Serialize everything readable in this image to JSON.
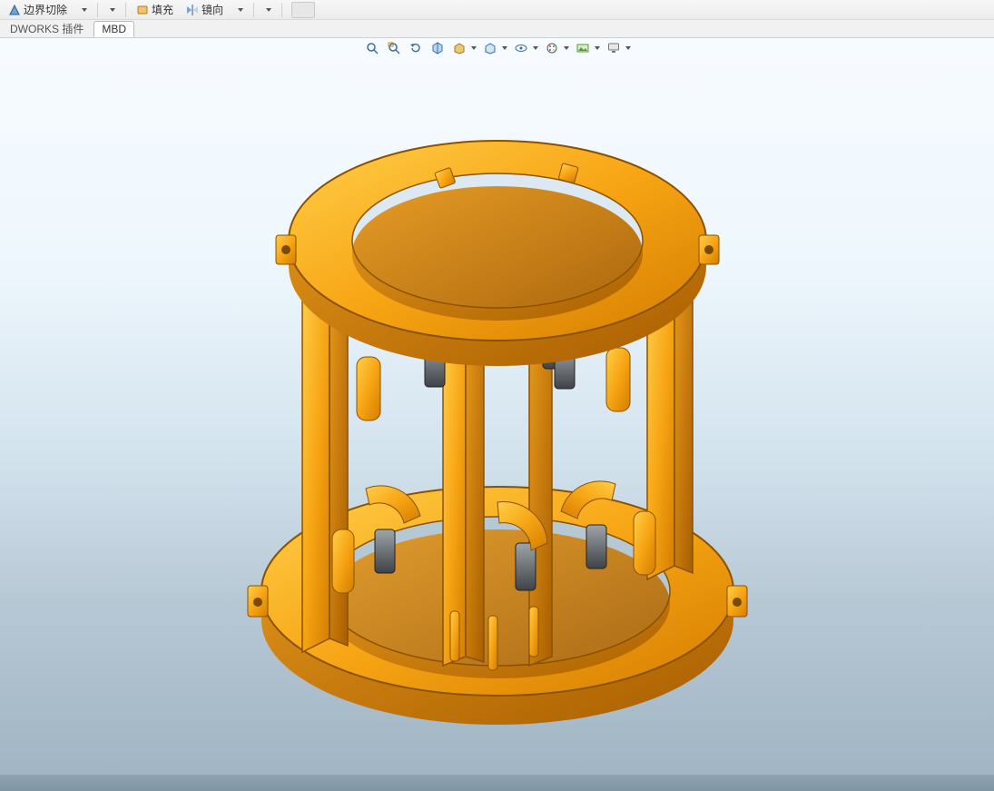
{
  "ribbon": {
    "cmd_boundary_cut": "边界切除",
    "cmd_fill": "填充",
    "cmd_mirror": "镜向"
  },
  "tabs": {
    "plugin": "DWORKS 插件",
    "mbd": "MBD"
  },
  "hud": {
    "icons": [
      "zoom-to-fit-icon",
      "zoom-window-icon",
      "prev-view-icon",
      "section-view-icon",
      "view-orient-icon",
      "display-style-icon",
      "hide-show-icon",
      "edit-appearance-icon",
      "apply-scene-icon",
      "view-settings-icon"
    ]
  },
  "model": {
    "description": "Orange cylindrical mechanical assembly with two rings, vertical columns, gear and actuator sub-assemblies"
  }
}
